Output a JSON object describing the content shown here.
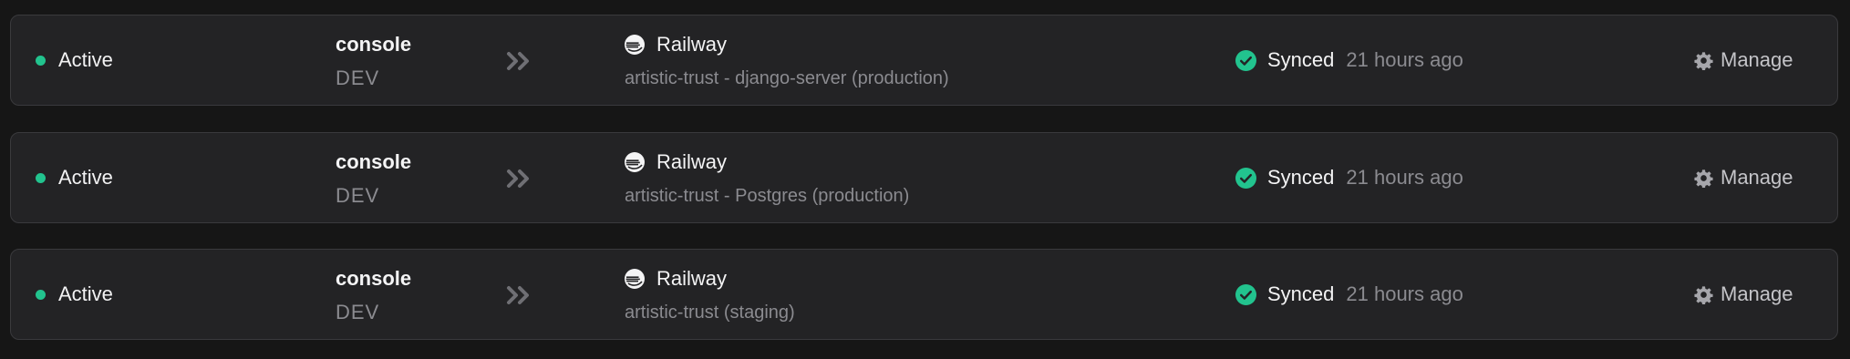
{
  "colors": {
    "active_dot": "#22c38e",
    "synced_check": "#22c38e",
    "row_background": "#232325",
    "page_background": "#161616"
  },
  "rows": [
    {
      "status": "Active",
      "environment": "console",
      "environment_tag": "DEV",
      "arrow_icon": "chevrons-right-icon",
      "provider_icon": "railway-logo-icon",
      "provider": "Railway",
      "target": "artistic-trust - django-server (production)",
      "sync_icon": "check-circle-icon",
      "sync_status": "Synced",
      "sync_time": "21 hours ago",
      "manage_icon": "gear-icon",
      "manage_label": "Manage"
    },
    {
      "status": "Active",
      "environment": "console",
      "environment_tag": "DEV",
      "arrow_icon": "chevrons-right-icon",
      "provider_icon": "railway-logo-icon",
      "provider": "Railway",
      "target": "artistic-trust - Postgres (production)",
      "sync_icon": "check-circle-icon",
      "sync_status": "Synced",
      "sync_time": "21 hours ago",
      "manage_icon": "gear-icon",
      "manage_label": "Manage"
    },
    {
      "status": "Active",
      "environment": "console",
      "environment_tag": "DEV",
      "arrow_icon": "chevrons-right-icon",
      "provider_icon": "railway-logo-icon",
      "provider": "Railway",
      "target": "artistic-trust (staging)",
      "sync_icon": "check-circle-icon",
      "sync_status": "Synced",
      "sync_time": "21 hours ago",
      "manage_icon": "gear-icon",
      "manage_label": "Manage"
    }
  ]
}
